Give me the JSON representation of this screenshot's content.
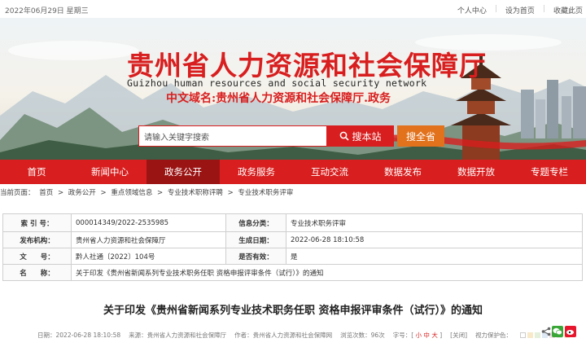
{
  "topbar": {
    "date": "2022年06月29日 星期三",
    "links": [
      "个人中心",
      "设为首页",
      "收藏此页"
    ]
  },
  "banner": {
    "title": "贵州省人力资源和社会保障厅",
    "subtitle": "Guizhou human resources and social security network",
    "domain": "中文域名:贵州省人力资源和社会保障厅.政务",
    "search_placeholder": "请输入关键字搜索",
    "search_button": "搜本站",
    "search_all_button": "搜全省"
  },
  "nav": [
    "首页",
    "新闻中心",
    "政务公开",
    "政务服务",
    "互动交流",
    "数据发布",
    "数据开放",
    "专题专栏"
  ],
  "nav_active": "政务公开",
  "breadcrumb": [
    "当前页面：",
    "首页",
    ">",
    "政务公开",
    ">",
    "重点领域信息",
    ">",
    "专业技术职称评聘",
    ">",
    "专业技术职务评审"
  ],
  "meta": {
    "index_label": "索 引 号：",
    "index_value": "000014349/2022-2535985",
    "category_label": "信息分类：",
    "category_value": "专业技术职务评审",
    "org_label": "发布机构：",
    "org_value": "贵州省人力资源和社会保障厅",
    "date_label": "生成日期：",
    "date_value": "2022-06-28 18:10:58",
    "doc_label": "文　　号：",
    "doc_value": "黔人社通〔2022〕104号",
    "valid_label": "是否有效：",
    "valid_value": "是",
    "name_label": "名　　称：",
    "name_value": "关于印发《贵州省新闻系列专业技术职务任职 资格申报评审条件（试行）》的通知"
  },
  "article": {
    "title": "关于印发《贵州省新闻系列专业技术职务任职 资格申报评审条件（试行）》的通知",
    "date": "日期：2022-06-28 18:10:58",
    "source": "来源：贵州省人力资源和社会保障厅",
    "author": "作者：贵州省人力资源和社会保障网",
    "views": "浏览次数：96次",
    "font_label": "字号：[",
    "font_small": "小",
    "font_mid": "中",
    "font_big": "大",
    "font_close": "]",
    "close": "[关闭]",
    "view_env": "视力保护色："
  },
  "colors": {
    "brand_red": "#d81e1e",
    "nav_active": "#9b1414",
    "orange": "#e2721c"
  },
  "eye_colors": [
    "#ffffff",
    "#f7e9c9",
    "#e5f0dc",
    "#dde9f4",
    "#f3e2e8",
    "#e9e9e9",
    "#f7f0d2"
  ]
}
